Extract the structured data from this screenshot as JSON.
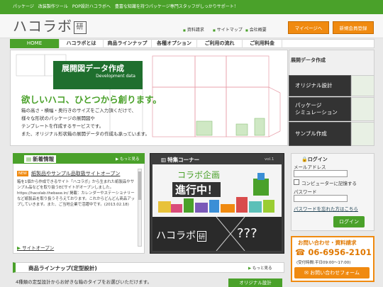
{
  "topstrip": {
    "text": "パッケージ　改装製作ツール　POP設計ハコラボへ　豊富な知識を持つパッケージ専門スタッフがしっかりサポート！"
  },
  "header": {
    "logo_text": "ハコラボ",
    "logo_mark": "研",
    "links": [
      "資料請求",
      "サイトマップ",
      "会社概要"
    ],
    "mypage_label": "マイページへ",
    "register_label": "新規会員登録"
  },
  "nav": {
    "items": [
      "HOME",
      "ハコラボとは",
      "商品ラインナップ",
      "各種オプション",
      "ご利用の流れ",
      "ご利用料金"
    ]
  },
  "hero": {
    "badge_title": "展開図データ作成",
    "badge_sub": "Development data",
    "heading": "欲しいハコ、ひとつから創ります。",
    "lines": [
      "箱の高さ・横幅・奥行きのサイズをご入力頂くだけで、",
      "様々な形状のパッケージの展開図や",
      "テンプレートを作成するサービスです。",
      "また、オリジナル形状箱の展開データの作成も承っています。"
    ]
  },
  "hero_menu": {
    "title": "展開データ作成",
    "items": [
      "オリジナル設計",
      "パッケージ\nシミュレーション",
      "サンプル作成"
    ]
  },
  "news": {
    "title": "新着情報",
    "more": "もっと見る",
    "tag": "NEW",
    "headline": "紙製品やサンプル品取扱サイトオープン",
    "body": "箱を1個から作成できるサイト「ハコラボ」から生まれた紙製品やサンプル品などを取り扱うECサイトがオープンしました。https://hacolab.thebase.in/ 掲載：カレンダーやステーショナリーなど紙製品を取り扱うそろえております。これからどんどん商品アップしていきます。また、ご当地企業で活躍中です。(2013.02.18)",
    "link": "サイトオープン"
  },
  "feature": {
    "title": "特集コーナー",
    "vol": "vol.1",
    "heading1": "コラボ企画",
    "heading2": "進行中！",
    "logo": "ハコラボ",
    "logo_mark": "研",
    "cross": "×",
    "qqq": "???"
  },
  "login": {
    "title": "ログイン",
    "email_label": "メールアドレス",
    "remember_label": "コンピューターに記憶する",
    "password_label": "パスワード",
    "forgot_link": "パスワードを忘れた方はこちら",
    "button": "ログイン"
  },
  "contact": {
    "title": "お問い合わせ・資料請求",
    "tel": "06-6956-2101",
    "hours": "(受付時間:平日09:00～17:00)",
    "button": "お問い合わせフォーム"
  },
  "lineup": {
    "title": "商品ラインナップ(定型設計)",
    "more": "もっと見る",
    "desc": "4種類の定型設計からお好きな箱のタイプをお選びいただけます。",
    "button": "オリジナル設計"
  },
  "colors": {
    "brand_green": "#4aa12a",
    "accent_orange": "#f08a10",
    "dark": "#333333"
  }
}
